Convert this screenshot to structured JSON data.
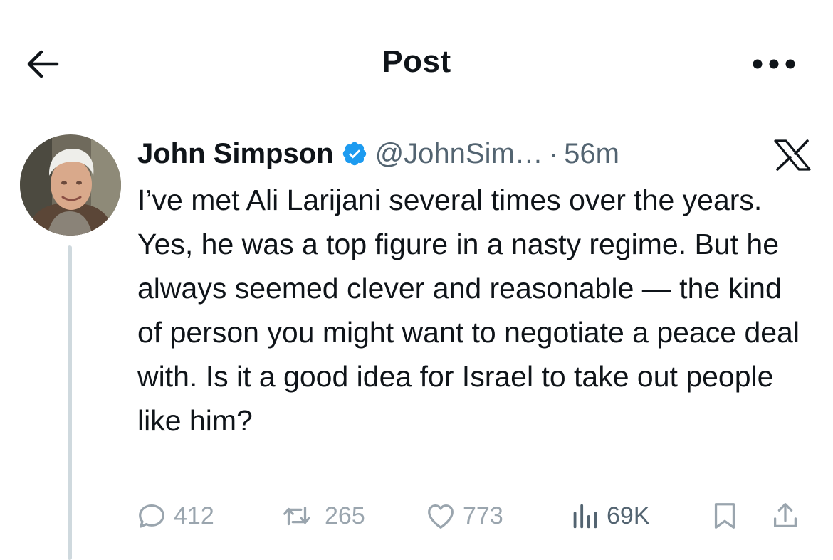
{
  "header": {
    "title": "Post",
    "back_icon": "arrow-left-icon",
    "more_icon": "more-horizontal-icon"
  },
  "post": {
    "author_name": "John Simpson",
    "verified_icon": "verified-badge-icon",
    "handle": "@JohnSim…",
    "separator": "·",
    "timestamp": "56m",
    "source_icon": "x-logo-icon",
    "text": "I’ve met Ali Larijani several times over the years. Yes, he was a top figure in a nasty regime. But he always seemed clever and reasonable — the kind of person you might want to negotiate a peace deal with. Is it a good idea for Israel to take out people like him?",
    "actions": {
      "replies": "412",
      "reposts": "265",
      "likes": "773",
      "views": "69K"
    }
  },
  "colors": {
    "text": "#0f1419",
    "secondary": "#536471",
    "muted": "#9aa5ae",
    "verified": "#1d9bf0",
    "thread_line": "#cfd9de"
  }
}
